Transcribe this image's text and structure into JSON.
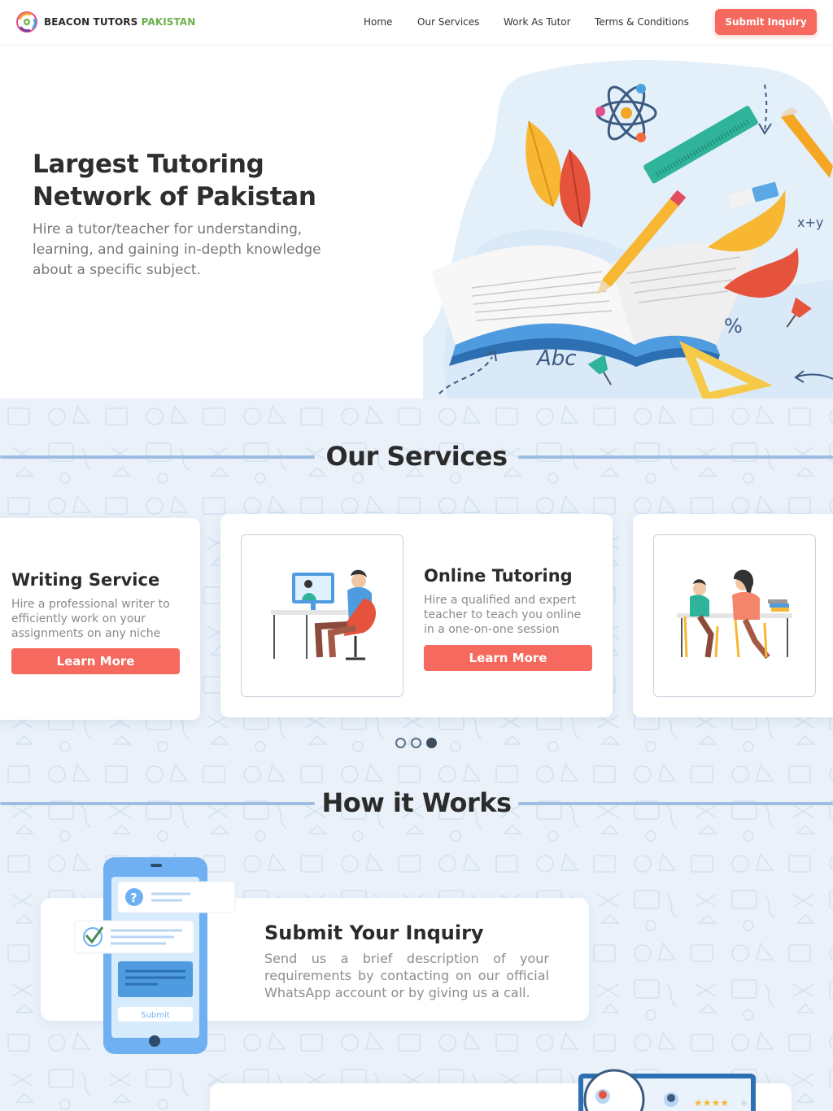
{
  "nav": {
    "brand_part1": "BEACON TUTORS",
    "brand_part2": "PAKISTAN",
    "links": [
      "Home",
      "Our Services",
      "Work As Tutor",
      "Terms & Conditions"
    ],
    "cta": "Submit Inquiry"
  },
  "hero": {
    "title": "Largest Tutoring Network of Pakistan",
    "subtitle": "Hire a tutor/teacher for understanding, learning, and gaining in-depth knowledge about a specific subject.",
    "art_text_1": "Abc",
    "art_text_2": "x+y",
    "art_text_3": "%"
  },
  "services": {
    "heading": "Our Services",
    "cards": [
      {
        "title": "Writing Service",
        "desc": "Hire a professional writer to efficiently work on your assignments on any niche",
        "button": "Learn More"
      },
      {
        "title": "Online Tutoring",
        "desc": "Hire a qualified and expert teacher to teach you online in a one-on-one session",
        "button": "Learn More"
      }
    ],
    "carousel_active_index": 2,
    "carousel_count": 3
  },
  "how": {
    "heading": "How it Works",
    "step_title": "Submit Your Inquiry",
    "step_desc": "Send us a brief description of your requirements by contacting on our official WhatsApp account or by giving us a call.",
    "phone_button": "Submit",
    "phone_question_mark": "?"
  },
  "colors": {
    "accent": "#f5695e",
    "brand_green": "#6bb24a",
    "section_line": "#9fbde2",
    "background": "#eaf1f9"
  }
}
